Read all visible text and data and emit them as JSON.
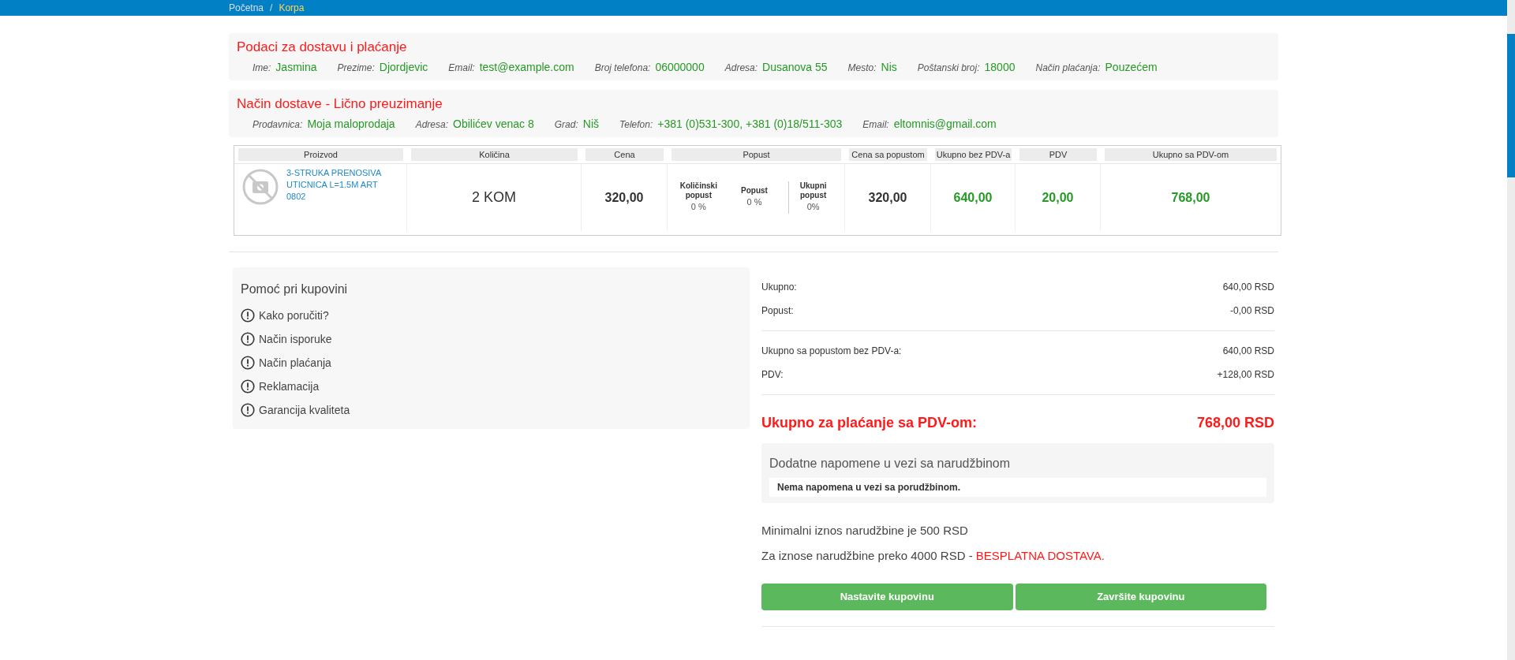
{
  "breadcrumb": [
    {
      "label": "Početna",
      "selected": false
    },
    {
      "label": "Korpa",
      "selected": true
    }
  ],
  "breadcrumb_separator": "/",
  "info_sections": [
    {
      "title": "Podaci za dostavu i plaćanje",
      "fields": [
        {
          "label": "Ime:",
          "value": "Jasmina"
        },
        {
          "label": "Prezime:",
          "value": "Djordjevic"
        },
        {
          "label": "Email:",
          "value": "test@example.com"
        },
        {
          "label": "Broj telefona:",
          "value": "06000000"
        },
        {
          "label": "Adresa:",
          "value": "Dusanova 55"
        },
        {
          "label": "Mesto:",
          "value": "Nis"
        },
        {
          "label": "Poštanski broj:",
          "value": "18000"
        },
        {
          "label": "Način plaćanja:",
          "value": "Pouzećem"
        }
      ]
    },
    {
      "title": "Način dostave - Lično preuzimanje",
      "fields": [
        {
          "label": "Prodavnica:",
          "value": "Moja maloprodaja"
        },
        {
          "label": "Adresa:",
          "value": "Obilićev venac 8"
        },
        {
          "label": "Grad:",
          "value": "Niš"
        },
        {
          "label": "Telefon:",
          "value": "+381 (0)531-300, +381 (0)18/511-303"
        },
        {
          "label": "Email:",
          "value": "eltomnis@gmail.com"
        }
      ]
    }
  ],
  "table": {
    "columns": [
      "Proizvod",
      "Količina",
      "Cena",
      "Popust",
      "Cena sa popustom",
      "Ukupno bez PDV-a",
      "PDV",
      "Ukupno sa PDV-om"
    ],
    "rows": [
      {
        "product": "3-STRUKA PRENOSIVA UTICNICA L=1.5M ART 0802",
        "quantity": "2 KOM",
        "price": "320,00",
        "discounts": [
          {
            "label": "Količinski popust",
            "value": "0 %"
          },
          {
            "label": "Popust",
            "value": "0 %"
          },
          {
            "label": "Ukupni popust",
            "value": "0%"
          }
        ],
        "discounted_price": "320,00",
        "total_without_vat": "640,00",
        "vat": "20,00",
        "total_with_vat": "768,00"
      }
    ]
  },
  "help": {
    "title": "Pomoć pri kupovini",
    "items": [
      "Kako poručiti?",
      "Način isporuke",
      "Način plaćanja",
      "Reklamacija",
      "Garancija kvaliteta"
    ]
  },
  "summary_groups": [
    [
      {
        "label": "Ukupno:",
        "value": "640,00 RSD"
      },
      {
        "label": "Popust:",
        "value": "-0,00 RSD"
      }
    ],
    [
      {
        "label": "Ukupno sa popustom bez PDV-a:",
        "value": "640,00 RSD"
      },
      {
        "label": "PDV:",
        "value": "+128,00 RSD"
      }
    ]
  ],
  "grand_total": {
    "label": "Ukupno za plaćanje sa PDV-om:",
    "value": "768,00 RSD"
  },
  "notes": {
    "title": "Dodatne napomene u vezi sa narudžbinom",
    "text": "Nema napomena u vezi sa porudžbinom."
  },
  "info_lines": [
    {
      "text": "Minimalni iznos narudžbine je 500 RSD"
    },
    {
      "text": "Za iznose narudžbine preko 4000 RSD - ",
      "highlight": "BESPLATNA DOSTAVA."
    }
  ],
  "buttons": [
    "Nastavite kupovinu",
    "Završite kupovinu"
  ]
}
